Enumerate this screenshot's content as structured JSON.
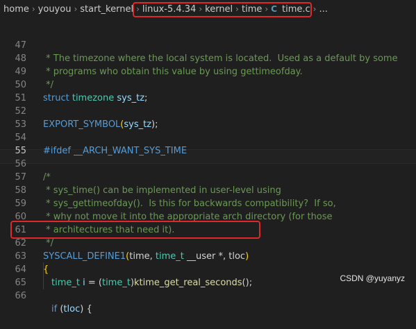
{
  "breadcrumb": {
    "items": [
      "home",
      "youyou",
      "start_kernel",
      "linux-5.4.34",
      "kernel",
      "time"
    ],
    "file_icon": "C",
    "file_name": "time.c",
    "ellipsis": "..."
  },
  "editor": {
    "lines": [
      {
        "num": "47",
        "c1": " * The timezone where the local system is located.  Used as a default by some"
      },
      {
        "num": "48",
        "c1": " * programs who obtain this value by using gettimeofday."
      },
      {
        "num": "49",
        "c1": " */"
      },
      {
        "num": "50",
        "c1": "struct",
        "c2": " ",
        "c3": "timezone",
        "c4": " ",
        "c5": "sys_tz",
        "c6": ";"
      },
      {
        "num": "51"
      },
      {
        "num": "52",
        "c1": "EXPORT_SYMBOL",
        "c2": "(",
        "c3": "sys_tz",
        "c4": ");"
      },
      {
        "num": "53"
      },
      {
        "num": "54",
        "c1": "#ifdef",
        "c2": " ",
        "c3": "__ARCH_WANT_SYS_TIME"
      },
      {
        "num": "55"
      },
      {
        "num": "56",
        "c1": "/*"
      },
      {
        "num": "57",
        "c1": " * sys_time() can be implemented in user-level using"
      },
      {
        "num": "58",
        "c1": " * sys_gettimeofday().  Is this for backwards compatibility?  If so,"
      },
      {
        "num": "59",
        "c1": " * why not move it into the appropriate arch directory (for those"
      },
      {
        "num": "60",
        "c1": " * architectures that need it)."
      },
      {
        "num": "61",
        "c1": " */"
      },
      {
        "num": "62",
        "c1": "SYSCALL_DEFINE1",
        "c2": "(",
        "c3": "time",
        "c4": ", ",
        "c5": "time_t",
        "c6": " ",
        "c7": "__user",
        "c8": " *, ",
        "c9": "tloc",
        "c10": ")"
      },
      {
        "num": "63",
        "c1": "{"
      },
      {
        "num": "64",
        "c1": "time_t",
        "c2": " ",
        "c3": "i",
        "c4": " = (",
        "c5": "time_t",
        "c6": ")",
        "c7": "ktime_get_real_seconds",
        "c8": "();"
      },
      {
        "num": "65"
      },
      {
        "num": "66",
        "c1": "if",
        "c2": " (",
        "c3": "tloc",
        "c4": ") {"
      }
    ]
  },
  "watermark": "CSDN @yuyanyz",
  "colors": {
    "background": "#1f1f1f",
    "comment": "#6a9955",
    "keyword": "#569cd6",
    "type": "#4ec9b0",
    "function": "#dcdcaa",
    "variable": "#9cdcfe",
    "highlight_box": "#e0282a"
  }
}
